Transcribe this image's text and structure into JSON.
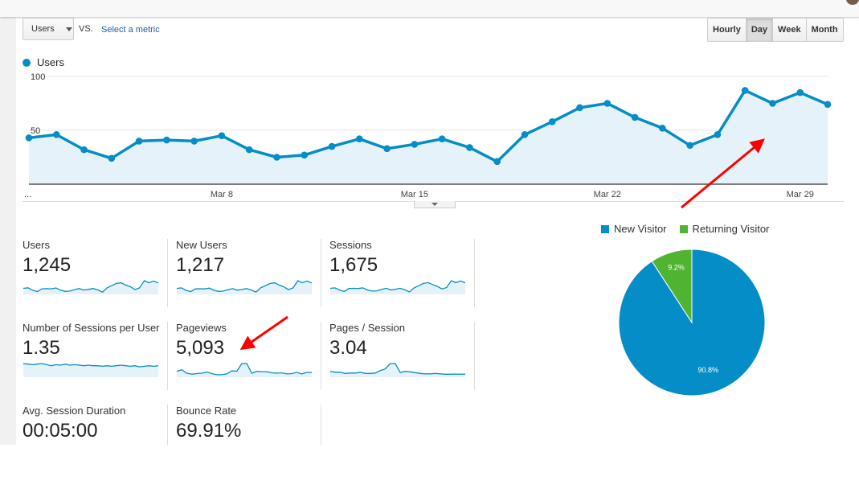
{
  "toolbar": {
    "metric_select": "Users",
    "vs_label": "VS.",
    "select_metric_link": "Select a metric",
    "periods": [
      {
        "label": "Hourly",
        "active": false
      },
      {
        "label": "Day",
        "active": true
      },
      {
        "label": "Week",
        "active": false
      },
      {
        "label": "Month",
        "active": false
      }
    ]
  },
  "colors": {
    "series": "#058dc7",
    "fill": "#e5f2f9",
    "new_visitor": "#058dc7",
    "returning_visitor": "#50b432",
    "annotation": "#ff0000"
  },
  "chart_data": [
    {
      "type": "area",
      "legend": [
        "Users"
      ],
      "y_ticks": [
        "100",
        "50"
      ],
      "ylim": [
        0,
        100
      ],
      "x_ticks": [
        {
          "index": 0,
          "label": "..."
        },
        {
          "index": 7,
          "label": "Mar 8"
        },
        {
          "index": 14,
          "label": "Mar 15"
        },
        {
          "index": 21,
          "label": "Mar 22"
        },
        {
          "index": 28,
          "label": "Mar 29"
        }
      ],
      "series": [
        {
          "name": "Users",
          "values": [
            43,
            46,
            32,
            24,
            40,
            41,
            40,
            45,
            32,
            25,
            27,
            35,
            42,
            33,
            37,
            42,
            34,
            21,
            46,
            58,
            71,
            75,
            62,
            52,
            36,
            46,
            87,
            75,
            85,
            74
          ]
        }
      ],
      "grid": true
    },
    {
      "type": "pie",
      "legend_placement": "top",
      "slices": [
        {
          "name": "New Visitor",
          "value": 90.8,
          "label": "90.8%"
        },
        {
          "name": "Returning Visitor",
          "value": 9.2,
          "label": "9.2%"
        }
      ]
    }
  ],
  "metrics": [
    {
      "label": "Users",
      "value": "1,245",
      "spark": [
        43,
        46,
        32,
        24,
        40,
        41,
        40,
        45,
        32,
        25,
        27,
        35,
        42,
        33,
        37,
        42,
        34,
        21,
        46,
        58,
        71,
        75,
        62,
        52,
        36,
        46,
        87,
        75,
        85,
        74
      ]
    },
    {
      "label": "New Users",
      "value": "1,217",
      "spark": [
        42,
        45,
        31,
        24,
        39,
        40,
        39,
        44,
        31,
        25,
        27,
        34,
        41,
        32,
        36,
        41,
        33,
        21,
        45,
        57,
        70,
        74,
        61,
        51,
        35,
        45,
        86,
        74,
        84,
        73
      ]
    },
    {
      "label": "Sessions",
      "value": "1,675",
      "spark": [
        56,
        60,
        44,
        33,
        55,
        56,
        55,
        60,
        44,
        36,
        38,
        48,
        57,
        45,
        50,
        57,
        46,
        30,
        60,
        75,
        92,
        98,
        84,
        70,
        52,
        62,
        112,
        98,
        110,
        97
      ]
    },
    {
      "label": "Number of Sessions per User",
      "value": "1.35",
      "spark": [
        50,
        49,
        48,
        49,
        50,
        48,
        46,
        48,
        47,
        49,
        47,
        48,
        47,
        46,
        47,
        46,
        46,
        45,
        46,
        45,
        46,
        47,
        46,
        45,
        46,
        44,
        45,
        46,
        45,
        46
      ]
    },
    {
      "label": "Pageviews",
      "value": "5,093",
      "spark": [
        40,
        48,
        30,
        25,
        28,
        30,
        36,
        28,
        22,
        22,
        26,
        42,
        40,
        80,
        80,
        30,
        40,
        38,
        38,
        32,
        30,
        32,
        26,
        28,
        34,
        26,
        34,
        34
      ]
    },
    {
      "label": "Pages / Session",
      "value": "3.04",
      "spark": [
        40,
        36,
        36,
        30,
        32,
        32,
        36,
        30,
        30,
        32,
        44,
        52,
        78,
        78,
        34,
        40,
        38,
        34,
        30,
        28,
        28,
        30,
        28,
        26,
        26,
        27,
        26,
        27
      ]
    },
    {
      "label": "Avg. Session Duration",
      "value": "00:05:00"
    },
    {
      "label": "Bounce Rate",
      "value": "69.91%"
    }
  ]
}
